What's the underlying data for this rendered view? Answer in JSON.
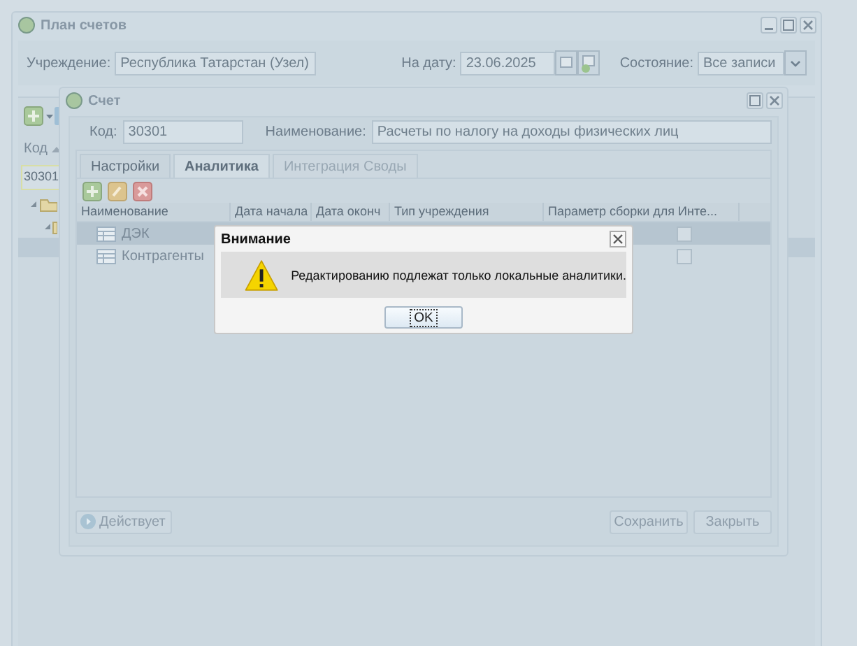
{
  "main_window": {
    "title": "План счетов",
    "fields": [
      {
        "label": "Учреждение:",
        "value": "Республика Татарстан (Узел)",
        "kind": "text"
      },
      {
        "label": "На дату:",
        "value": "23.06.2025",
        "kind": "date"
      },
      {
        "label": "Состояние:",
        "value": "Все записи",
        "kind": "select"
      }
    ],
    "grid": {
      "columns": [
        "Код"
      ],
      "filter_value": "30301"
    }
  },
  "account_window": {
    "title": "Счет",
    "code_label": "Код:",
    "code": "30301",
    "name_label": "Наименование:",
    "name": "Расчеты по налогу на доходы физических лиц",
    "tabs": [
      {
        "label": "Настройки",
        "selected": false,
        "disabled": false
      },
      {
        "label": "Аналитика",
        "selected": true,
        "disabled": false
      },
      {
        "label": "Интеграция Своды",
        "selected": false,
        "disabled": true
      }
    ],
    "columns": [
      "Наименование",
      "Дата начала",
      "Дата оконч",
      "Тип учреждения",
      "Параметр сборки для Инте..."
    ],
    "rows": [
      {
        "name": "ДЭК",
        "selected": true,
        "checked": false
      },
      {
        "name": "Контрагенты",
        "selected": false,
        "checked": false
      }
    ],
    "status_button": "Действует",
    "buttons": [
      "Сохранить",
      "Закрыть"
    ]
  },
  "dialog": {
    "title": "Внимание",
    "message": "Редактированию подлежат только локальные аналитики.",
    "buttons": [
      "OK"
    ]
  }
}
